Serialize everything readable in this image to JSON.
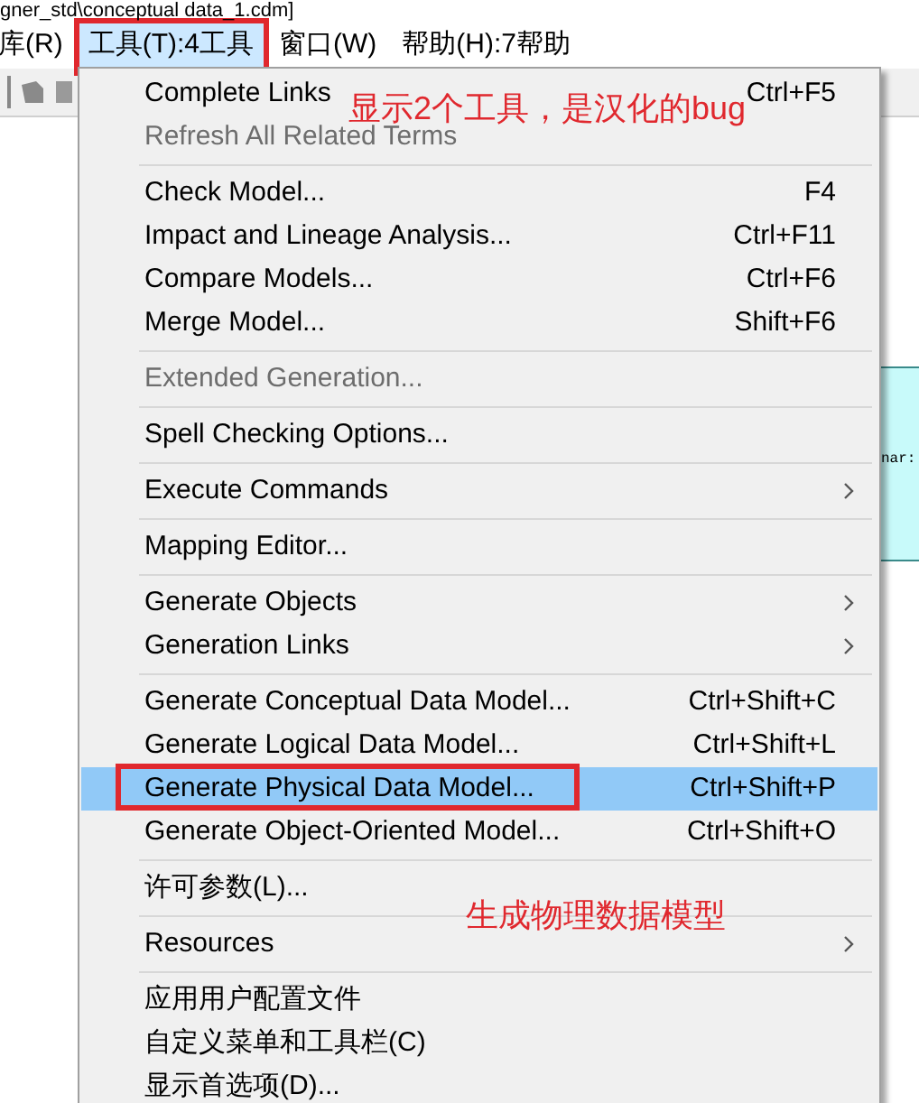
{
  "window": {
    "title": "gner_std\\conceptual data_1.cdm]"
  },
  "menu_bar": [
    {
      "label": "库(R)",
      "selected": false,
      "annotated": false
    },
    {
      "label": "工具(T):4工具",
      "selected": true,
      "annotated": true
    },
    {
      "label": "窗口(W)",
      "selected": false,
      "annotated": false
    },
    {
      "label": "帮助(H):7帮助",
      "selected": false,
      "annotated": false
    }
  ],
  "canvas": {
    "symbol_text": "nar:"
  },
  "menu": [
    [
      {
        "label": "Complete Links",
        "shortcut": "Ctrl+F5",
        "disabled": false,
        "submenu": false,
        "selected": false,
        "annotated": false
      },
      {
        "label": "Refresh All Related Terms",
        "disabled": true,
        "submenu": false,
        "selected": false,
        "annotated": false
      }
    ],
    [
      {
        "label": "Check Model...",
        "shortcut": "F4",
        "disabled": false,
        "submenu": false,
        "selected": false,
        "annotated": false
      },
      {
        "label": "Impact and Lineage Analysis...",
        "shortcut": "Ctrl+F11",
        "disabled": false,
        "submenu": false,
        "selected": false,
        "annotated": false
      },
      {
        "label": "Compare Models...",
        "shortcut": "Ctrl+F6",
        "disabled": false,
        "submenu": false,
        "selected": false,
        "annotated": false
      },
      {
        "label": "Merge Model...",
        "shortcut": "Shift+F6",
        "disabled": false,
        "submenu": false,
        "selected": false,
        "annotated": false
      }
    ],
    [
      {
        "label": "Extended Generation...",
        "disabled": true,
        "submenu": false,
        "selected": false,
        "annotated": false
      }
    ],
    [
      {
        "label": "Spell Checking Options...",
        "disabled": false,
        "submenu": false,
        "selected": false,
        "annotated": false
      }
    ],
    [
      {
        "label": "Execute Commands",
        "disabled": false,
        "submenu": true,
        "selected": false,
        "annotated": false
      }
    ],
    [
      {
        "label": "Mapping Editor...",
        "disabled": false,
        "submenu": false,
        "selected": false,
        "annotated": false
      }
    ],
    [
      {
        "label": "Generate Objects",
        "disabled": false,
        "submenu": true,
        "selected": false,
        "annotated": false
      },
      {
        "label": "Generation Links",
        "disabled": false,
        "submenu": true,
        "selected": false,
        "annotated": false
      }
    ],
    [
      {
        "label": "Generate Conceptual Data Model...",
        "shortcut": "Ctrl+Shift+C",
        "disabled": false,
        "submenu": false,
        "selected": false,
        "annotated": false
      },
      {
        "label": "Generate Logical Data Model...",
        "shortcut": "Ctrl+Shift+L",
        "disabled": false,
        "submenu": false,
        "selected": false,
        "annotated": false
      },
      {
        "label": "Generate Physical Data Model...",
        "shortcut": "Ctrl+Shift+P",
        "disabled": false,
        "submenu": false,
        "selected": true,
        "annotated": true
      },
      {
        "label": "Generate Object-Oriented Model...",
        "shortcut": "Ctrl+Shift+O",
        "disabled": false,
        "submenu": false,
        "selected": false,
        "annotated": false
      }
    ],
    [
      {
        "label": "许可参数(L)...",
        "disabled": false,
        "submenu": false,
        "selected": false,
        "annotated": false
      }
    ],
    [
      {
        "label": "Resources",
        "disabled": false,
        "submenu": true,
        "selected": false,
        "annotated": false
      }
    ],
    [
      {
        "label": "应用用户配置文件",
        "disabled": false,
        "submenu": false,
        "selected": false,
        "annotated": false
      },
      {
        "label": "自定义菜单和工具栏(C)",
        "disabled": false,
        "submenu": false,
        "selected": false,
        "annotated": false
      },
      {
        "label": "显示首选项(D)...",
        "disabled": false,
        "submenu": false,
        "selected": false,
        "annotated": false
      }
    ]
  ],
  "annotations": [
    "显示2个工具，是汉化的bug",
    "生成物理数据模型"
  ]
}
